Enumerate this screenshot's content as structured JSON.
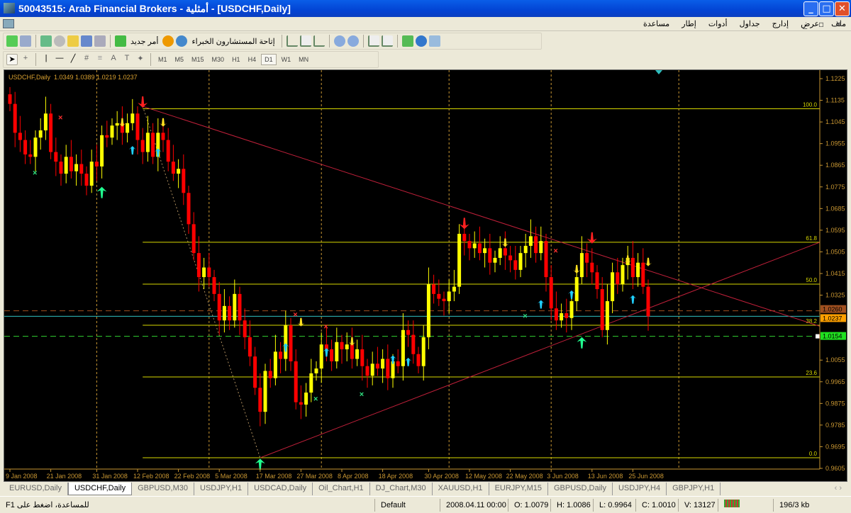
{
  "window": {
    "title": "50043515: Arab Financial Brokers - أمثلية - [USDCHF,Daily]"
  },
  "menu": [
    "ملف",
    "عرض",
    "إدارج",
    "جداول",
    "أدوات",
    "إطار",
    "مساعدة"
  ],
  "toolbar": {
    "new_order": "أمر جديد",
    "expert_advisors": "إتاحة المستشارون الخبراء"
  },
  "timeframes": [
    "M1",
    "M5",
    "M15",
    "M30",
    "H1",
    "H4",
    "D1",
    "W1",
    "MN"
  ],
  "active_timeframe": "D1",
  "chart_header": "USDCHF,Daily  1.0349 1.0389 1.0219 1.0237",
  "tabs": [
    "EURUSD,Daily",
    "USDCHF,Daily",
    "GBPUSD,M30",
    "USDJPY,H1",
    "USDCAD,Daily",
    "Oil_Chart,H1",
    "DJ_Chart,M30",
    "XAUUSD,H1",
    "EURJPY,M15",
    "GBPUSD,Daily",
    "USDJPY,H4",
    "GBPJPY,H1"
  ],
  "active_tab": "USDCHF,Daily",
  "status": {
    "help": "للمساعدة، اضغط على F1",
    "profile": "Default",
    "datetime": "2008.04.11 00:00",
    "open": "O: 1.0079",
    "high": "H: 1.0086",
    "low": "L: 0.9964",
    "close": "C: 1.0010",
    "volume": "V: 13127",
    "traffic": "196/3 kb"
  },
  "colors": {
    "bull": "#ffff00",
    "bear": "#ff0000",
    "axis": "#c89632",
    "fib": "#d8d800",
    "trend": "#c0203a",
    "bid": "#ffa000",
    "ask": "#20e020"
  },
  "chart_data": {
    "type": "candlestick",
    "symbol": "USDCHF",
    "timeframe": "Daily",
    "ylim": [
      0.9605,
      1.1225
    ],
    "yticks": [
      "1.1225",
      "1.1135",
      "1.1045",
      "1.0955",
      "1.0865",
      "1.0775",
      "1.0685",
      "1.0595",
      "1.0505",
      "1.0415",
      "1.0325",
      "1.0055",
      "0.9965",
      "0.9875",
      "0.9785",
      "0.9695",
      "0.9605"
    ],
    "xticks": [
      {
        "label": "9 Jan 2008",
        "index": 0
      },
      {
        "label": "21 Jan 2008",
        "index": 8
      },
      {
        "label": "31 Jan 2008",
        "index": 17
      },
      {
        "label": "12 Feb 2008",
        "index": 25
      },
      {
        "label": "22 Feb 2008",
        "index": 33
      },
      {
        "label": "5 Mar 2008",
        "index": 41
      },
      {
        "label": "17 Mar 2008",
        "index": 49
      },
      {
        "label": "27 Mar 2008",
        "index": 57
      },
      {
        "label": "8 Apr 2008",
        "index": 65
      },
      {
        "label": "18 Apr 2008",
        "index": 73
      },
      {
        "label": "30 Apr 2008",
        "index": 82
      },
      {
        "label": "12 May 2008",
        "index": 90
      },
      {
        "label": "22 May 2008",
        "index": 98
      },
      {
        "label": "3 Jun 2008",
        "index": 106
      },
      {
        "label": "13 Jun 2008",
        "index": 114
      },
      {
        "label": "25 Jun 2008",
        "index": 122
      }
    ],
    "first_open": 1.116,
    "closes": [
      1.112,
      1.1,
      1.097,
      1.091,
      1.09,
      1.098,
      1.101,
      1.108,
      1.092,
      1.088,
      1.083,
      1.09,
      1.084,
      1.087,
      1.083,
      1.078,
      1.088,
      1.086,
      1.099,
      1.098,
      1.103,
      1.104,
      1.1,
      1.104,
      1.108,
      1.097,
      1.092,
      1.1,
      1.09,
      1.1,
      1.097,
      1.088,
      1.083,
      1.085,
      1.075,
      1.062,
      1.05,
      1.04,
      1.044,
      1.04,
      1.033,
      1.022,
      1.028,
      1.022,
      1.033,
      1.022,
      1.015,
      1.007,
      0.994,
      0.984,
      1.001,
      0.998,
      1.009,
      1.006,
      1.02,
      1.005,
      0.988,
      0.987,
      0.992,
      1.0,
      1.002,
      1.012,
      1.01,
      1.005,
      1.013,
      1.01,
      1.012,
      1.006,
      1.01,
      1.003,
      0.999,
      1.004,
      1.002,
      1.006,
      0.998,
      1.005,
      1.003,
      1.018,
      1.016,
      1.008,
      1.003,
      1.015,
      1.037,
      1.033,
      1.031,
      1.03,
      1.034,
      1.036,
      1.058,
      1.055,
      1.052,
      1.054,
      1.05,
      1.052,
      1.046,
      1.048,
      1.052,
      1.049,
      1.047,
      1.043,
      1.05,
      1.053,
      1.057,
      1.05,
      1.055,
      1.04,
      1.027,
      1.022,
      1.025,
      1.023,
      1.03,
      1.04,
      1.05,
      1.046,
      1.042,
      1.035,
      1.018,
      1.03,
      1.042,
      1.037,
      1.045,
      1.048,
      1.04,
      1.046,
      1.036,
      1.0237
    ],
    "fib_levels": [
      {
        "label": "100.0",
        "price": 1.11
      },
      {
        "label": "61.8",
        "price": 1.0545
      },
      {
        "label": "50.0",
        "price": 1.0371
      },
      {
        "label": "38.2",
        "price": 1.02
      },
      {
        "label": "23.6",
        "price": 0.9985
      },
      {
        "label": "0.0",
        "price": 0.9649
      }
    ],
    "fib_anchor": [
      {
        "index": 26,
        "price": 1.111
      },
      {
        "index": 49,
        "price": 0.9649
      }
    ],
    "trendlines": [
      {
        "from": {
          "index": 26,
          "price": 1.111
        },
        "to": {
          "index": 158,
          "price": 1.02
        }
      },
      {
        "from": {
          "index": 49,
          "price": 0.9649
        },
        "to": {
          "index": 158,
          "price": 1.054
        }
      }
    ],
    "price_lines": [
      {
        "price": 1.026,
        "label": "1.0260",
        "style": "bid"
      },
      {
        "price": 1.0237,
        "label": "1.0237",
        "style": "current"
      },
      {
        "price": 1.0154,
        "label": "1.0154",
        "style": "alert"
      }
    ],
    "signals": [
      {
        "index": 10,
        "price": 1.1065,
        "type": "x-red"
      },
      {
        "index": 5,
        "price": 1.0835,
        "type": "x-green"
      },
      {
        "index": 18,
        "price": 1.0755,
        "type": "up-big"
      },
      {
        "index": 26,
        "price": 1.1125,
        "type": "down-red"
      },
      {
        "index": 49,
        "price": 0.9625,
        "type": "up-big"
      },
      {
        "index": 56,
        "price": 1.0245,
        "type": "x-red"
      },
      {
        "index": 62,
        "price": 1.0195,
        "type": "x-red"
      },
      {
        "index": 60,
        "price": 0.9895,
        "type": "x-green"
      },
      {
        "index": 69,
        "price": 0.9915,
        "type": "x-green"
      },
      {
        "index": 89,
        "price": 1.062,
        "type": "down-red"
      },
      {
        "index": 107,
        "price": 1.051,
        "type": "x-red"
      },
      {
        "index": 101,
        "price": 1.024,
        "type": "x-green"
      },
      {
        "index": 114,
        "price": 1.056,
        "type": "down-red"
      },
      {
        "index": 112,
        "price": 1.013,
        "type": "up-big"
      },
      {
        "index": 24,
        "price": 1.093,
        "type": "up-cyan"
      },
      {
        "index": 29,
        "price": 1.092,
        "type": "up-cyan"
      },
      {
        "index": 54,
        "price": 1.011,
        "type": "up-cyan"
      },
      {
        "index": 62,
        "price": 1.009,
        "type": "up-cyan"
      },
      {
        "index": 75,
        "price": 1.006,
        "type": "up-cyan"
      },
      {
        "index": 78,
        "price": 1.005,
        "type": "up-cyan"
      },
      {
        "index": 104,
        "price": 1.029,
        "type": "up-cyan"
      },
      {
        "index": 110,
        "price": 1.033,
        "type": "up-cyan"
      },
      {
        "index": 122,
        "price": 1.031,
        "type": "up-cyan"
      },
      {
        "index": 22,
        "price": 1.104,
        "type": "down-yellow"
      },
      {
        "index": 30,
        "price": 1.104,
        "type": "down-yellow"
      },
      {
        "index": 57,
        "price": 1.021,
        "type": "down-yellow"
      },
      {
        "index": 67,
        "price": 1.013,
        "type": "down-yellow"
      },
      {
        "index": 97,
        "price": 1.054,
        "type": "down-yellow"
      },
      {
        "index": 111,
        "price": 1.043,
        "type": "down-yellow"
      },
      {
        "index": 121,
        "price": 1.047,
        "type": "down-yellow"
      },
      {
        "index": 125,
        "price": 1.046,
        "type": "down-yellow"
      }
    ]
  }
}
